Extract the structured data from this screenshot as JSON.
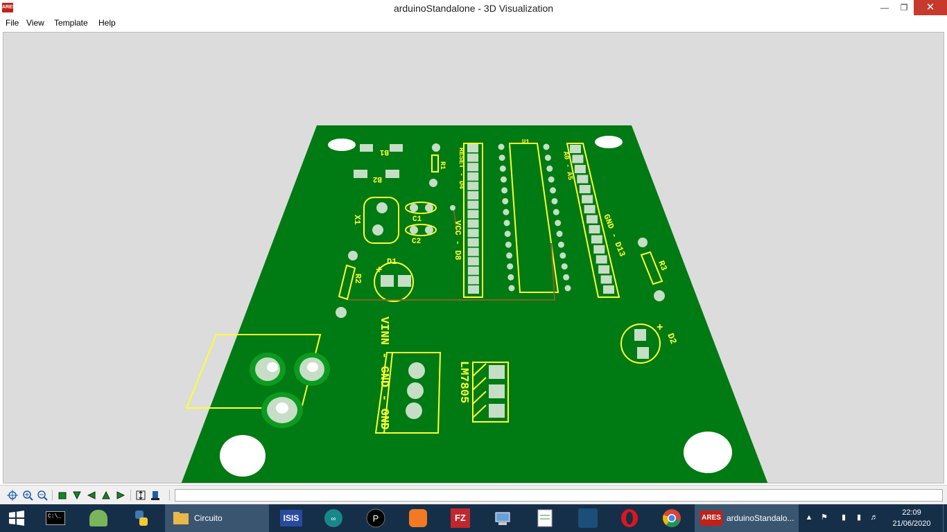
{
  "window": {
    "title": "arduinoStandalone - 3D Visualization",
    "logo": "ARES"
  },
  "menu": [
    "File",
    "View",
    "Template",
    "Help"
  ],
  "board": {
    "labels": {
      "b1": "B1",
      "b2": "B2",
      "r1": "R1",
      "x1": "X1",
      "c1": "C1",
      "c2": "C2",
      "d1": "D1",
      "r2": "R2",
      "u1": "U1",
      "r3": "R3",
      "d2": "D2",
      "reset": "RESET - D4",
      "vcc": "VCC - D8",
      "a0": "A0 - A5",
      "gnd13": "GND - D13",
      "vinn": "VINN - GND - GND",
      "reg": "LM7805",
      "plus1": "+",
      "plus2": "+"
    }
  },
  "toolbar": {
    "icons": [
      "pan-icon",
      "zoom-in-icon",
      "zoom-out-icon",
      "top-view-icon",
      "front-view-icon",
      "left-view-icon",
      "back-view-icon",
      "right-view-icon",
      "height-icon",
      "component-icon"
    ]
  },
  "taskbar": {
    "apps": [
      {
        "name": "cmd",
        "label": ""
      },
      {
        "name": "android-studio",
        "label": ""
      },
      {
        "name": "python",
        "label": ""
      },
      {
        "name": "file-explorer",
        "label": "Circuito"
      },
      {
        "name": "isis",
        "label": "ISIS"
      },
      {
        "name": "arduino",
        "label": ""
      },
      {
        "name": "pycharm",
        "label": ""
      },
      {
        "name": "xampp",
        "label": ""
      },
      {
        "name": "filezilla",
        "label": "FZ"
      },
      {
        "name": "network",
        "label": ""
      },
      {
        "name": "notepad",
        "label": ""
      },
      {
        "name": "mysql",
        "label": ""
      },
      {
        "name": "opera",
        "label": ""
      },
      {
        "name": "chrome",
        "label": ""
      },
      {
        "name": "ares",
        "label": "arduinoStandalo..."
      }
    ],
    "time": "22:09",
    "date": "21/06/2020"
  },
  "colors": {
    "pcb": "#007a12",
    "silk": "#ffff33",
    "pad": "#c5dec5",
    "taskbar": "#162f49"
  }
}
